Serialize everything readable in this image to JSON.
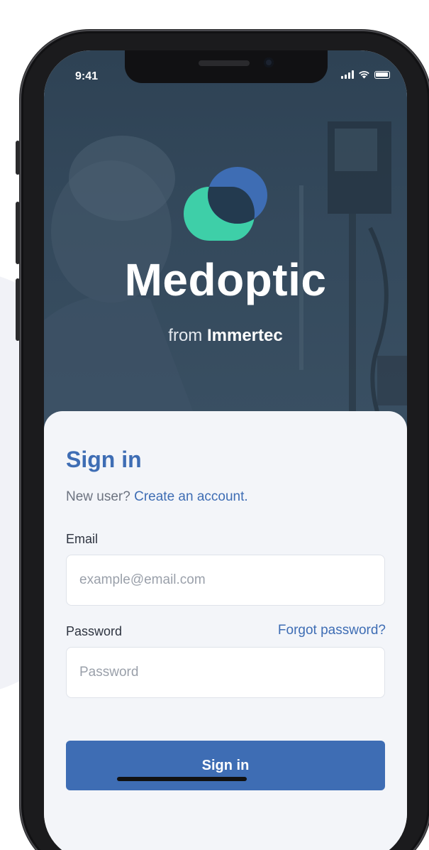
{
  "status_bar": {
    "time": "9:41",
    "icons": [
      "signal-icon",
      "wifi-icon",
      "battery-icon"
    ]
  },
  "brand": {
    "name": "Medoptic",
    "from": "from",
    "company": "Immertec",
    "logo_icon": "medoptic-logo-icon",
    "colors": {
      "green": "#3ecfa8",
      "blue": "#3e6db4",
      "overlap": "#233a4f"
    }
  },
  "signin": {
    "title": "Sign in",
    "new_user_prompt": "New user?",
    "create_account_link": "Create an account.",
    "email_label": "Email",
    "email_placeholder": "example@email.com",
    "email_value": "",
    "password_label": "Password",
    "forgot_link": "Forgot password?",
    "password_placeholder": "Password",
    "password_value": "",
    "submit_label": "Sign in"
  },
  "colors": {
    "accent": "#3e6db4",
    "hero_overlay": "#34495c",
    "card_background": "#f3f5f9"
  }
}
